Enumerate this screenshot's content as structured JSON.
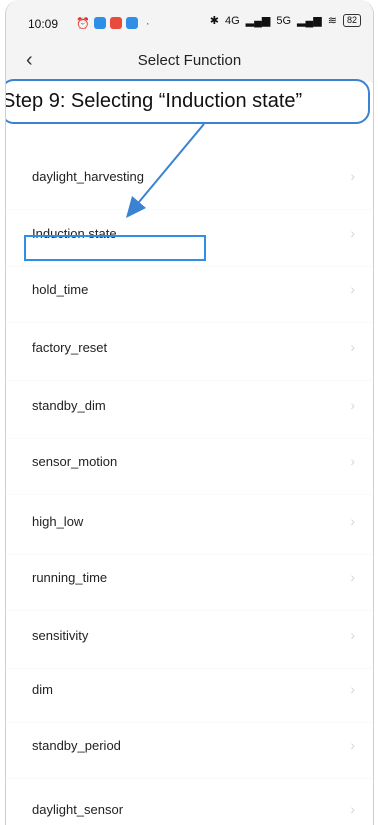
{
  "status_bar": {
    "time": "10:09",
    "battery": "82",
    "network_4g": "4G",
    "network_5g": "5G",
    "app_icon_colors": [
      "#2f8fe6",
      "#e84a3c",
      "#2f8fe6"
    ]
  },
  "header": {
    "back_icon": "chevron-left",
    "title": "Select Function"
  },
  "callout": {
    "text": "Step 9: Selecting “Induction state”",
    "color": "#3a82d2"
  },
  "functions": [
    "daylight_harvesting",
    "Induction state",
    "hold_time",
    "factory_reset",
    "standby_dim",
    "sensor_motion",
    "high_low",
    "running_time",
    "sensitivity",
    "dim",
    "standby_period",
    "daylight_sensor"
  ],
  "selected_function": "Induction state",
  "highlight_color": "#2f8fe6"
}
